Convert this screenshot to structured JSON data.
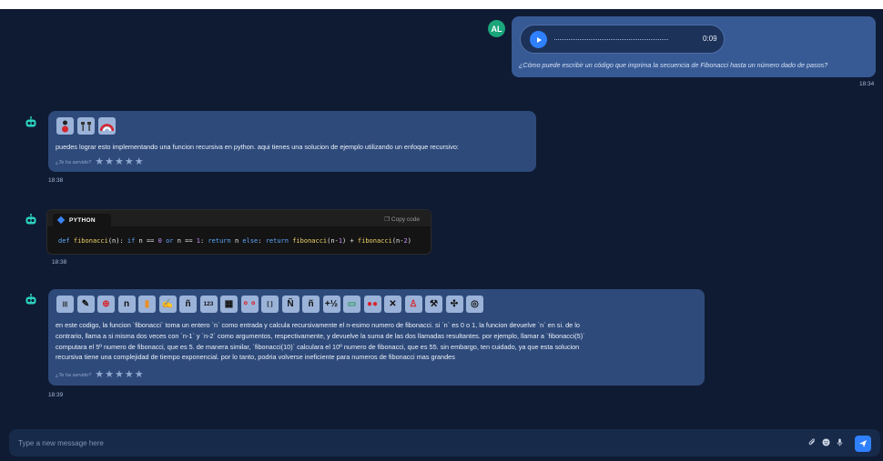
{
  "user": {
    "avatar_initials": "AL",
    "audio_duration": "0:09",
    "message": "¿Cómo puede escribir un código que imprima la secuencia de Fibonacci hasta un número dado de pasos?",
    "time": "18:34"
  },
  "bot_message_1": {
    "pictograms": [
      "person-icon",
      "tools-icon",
      "rainbow-icon"
    ],
    "text": "puedes lograr esto implementando una funcion recursiva en python. aqui tienes una solucion de ejemplo utilizando un enfoque recursivo:",
    "rating_label": "¿Te ha servido?",
    "time": "18:38"
  },
  "code_message": {
    "language": "PYTHON",
    "copy_label": "Copy code",
    "code": "def fibonacci(n): if n == 0 or n == 1: return n else: return fibonacci(n-1) + fibonacci(n-2)",
    "time": "18:38"
  },
  "bot_message_3": {
    "pictograms": [
      "barcode-icon",
      "pencil-icon",
      "target-icon",
      "letter-n-icon",
      "book-icon",
      "writing-hand-icon",
      "letter-ñ-icon",
      "numbers-123-icon",
      "map-icon",
      "connection-icon",
      "bracket-icon",
      "letter-Ñ-icon",
      "letter-ñ-lower-icon",
      "plus-fraction-icon",
      "calculator-icon",
      "dots-icon",
      "satellite-icon",
      "figure-icon",
      "tools-icon",
      "puzzle-icon",
      "cycle-icon"
    ],
    "text_lines": [
      "en este codigo, la funcion `fibonacci` toma un entero `n` como entrada y calcula recursivamente el n-esimo numero de fibonacci. si `n` es 0 o 1, la funcion devuelve `n` en si. de lo",
      "contrario, llama a si misma dos veces con `n-1` y `n-2` como argumentos, respectivamente, y devuelve la suma de las dos llamadas resultantes. por ejemplo, llamar a `fibonacci(5)`",
      "computara el 5º numero de fibonacci, que es 5. de manera similar, `fibonacci(10)` calculara el 10º numero de fibonacci, que es 55. sin embargo, ten cuidado, ya que esta solucion",
      "recursiva tiene una complejidad de tiempo exponencial. por lo tanto, podria volverse ineficiente para numeros de fibonacci mas grandes"
    ],
    "rating_label": "¿Te ha servido?",
    "time": "18:39"
  },
  "input": {
    "placeholder": "Type a new message here"
  },
  "colors": {
    "background": "#0f1b33",
    "user_bubble": "#375a95",
    "bot_bubble": "#2e4a7a",
    "accent": "#2f80ff",
    "avatar_user": "#1aa57a"
  }
}
